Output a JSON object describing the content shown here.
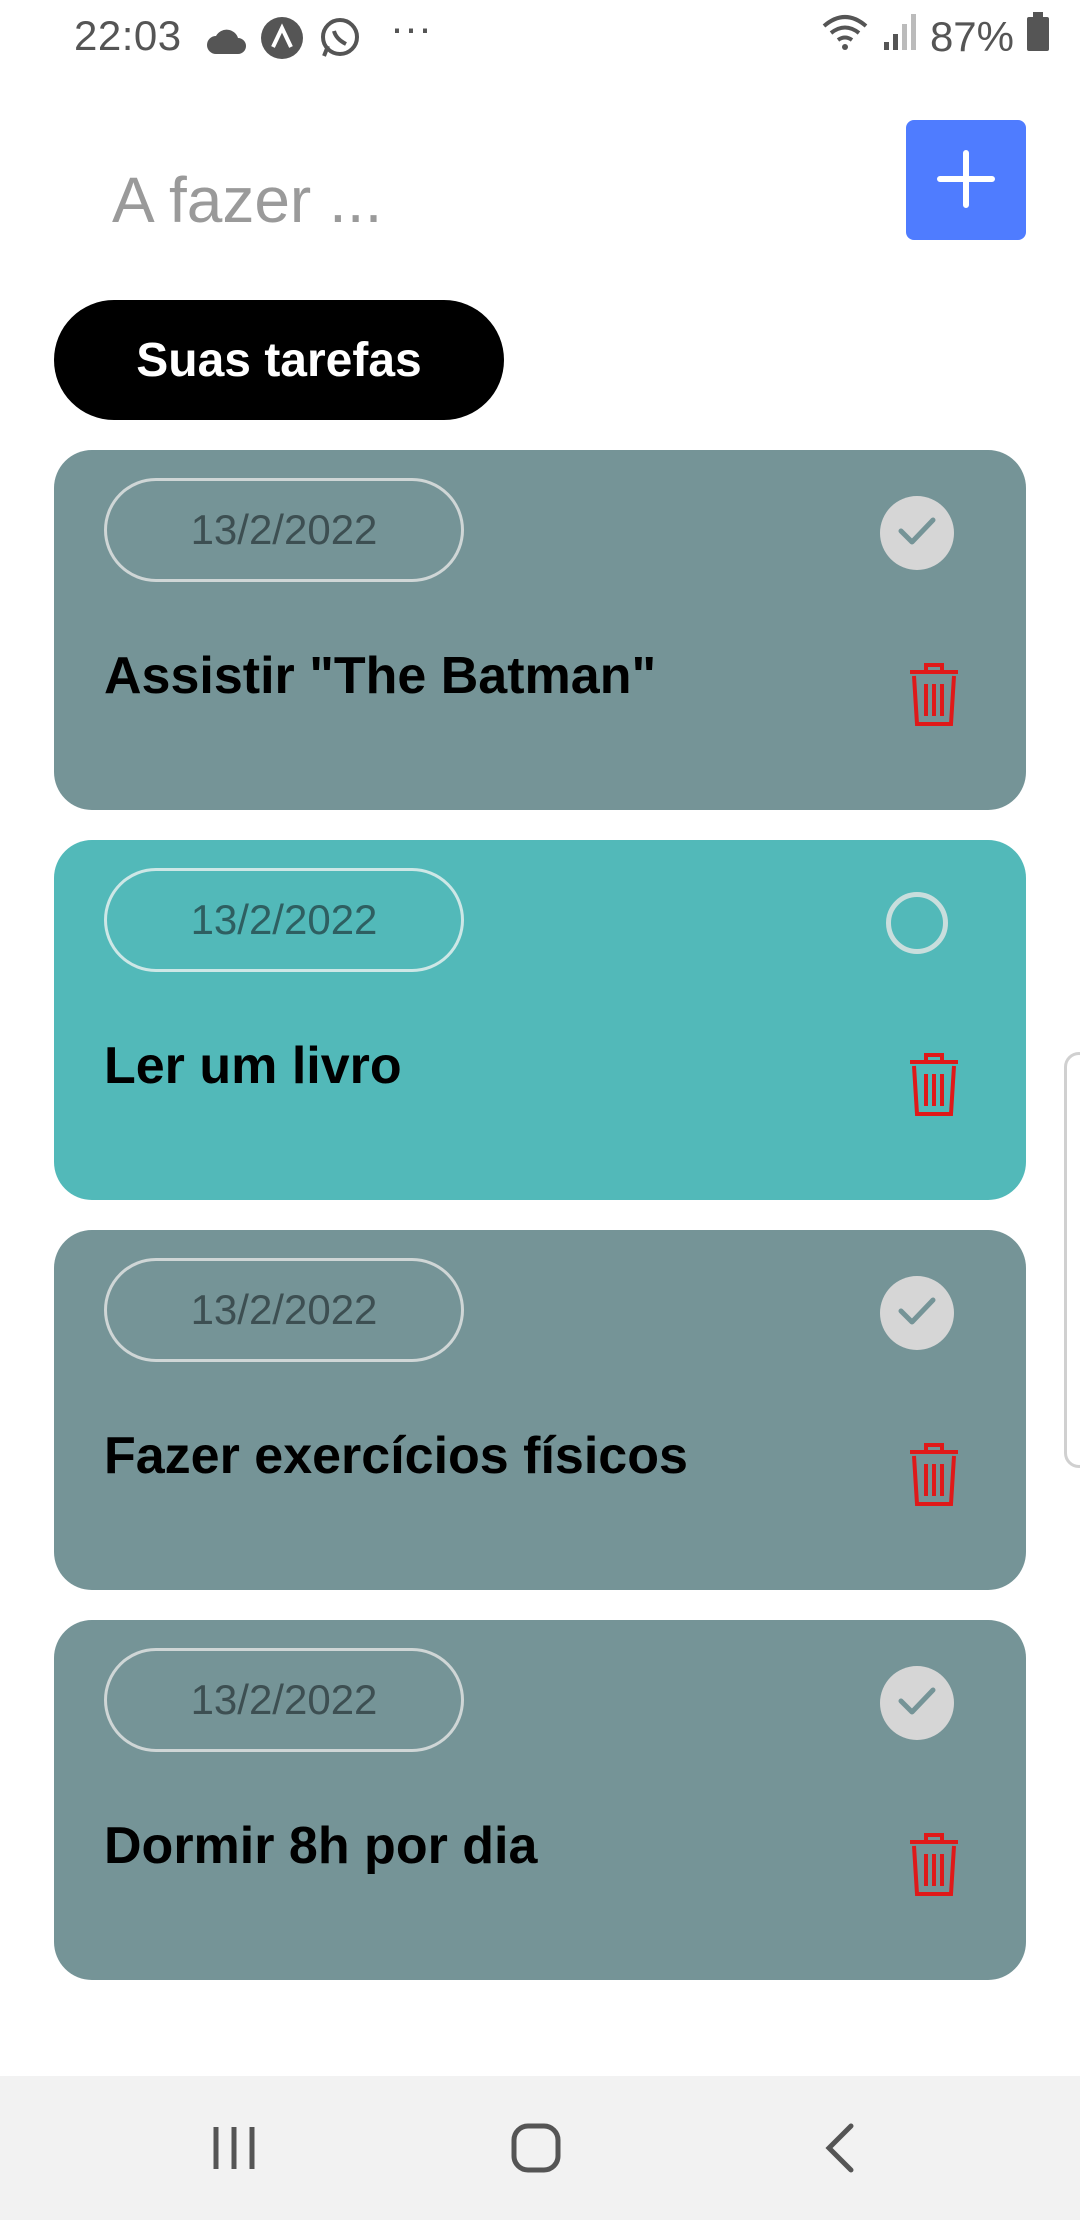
{
  "status_bar": {
    "time": "22:03",
    "battery": "87%",
    "icons": [
      "cloud-icon",
      "app-a-icon",
      "whatsapp-icon",
      "more-icon",
      "wifi-icon",
      "signal-icon",
      "battery-icon"
    ]
  },
  "add_form": {
    "placeholder": "A fazer ...",
    "value": "",
    "add_icon": "plus-icon",
    "accent_color": "#4f7cff"
  },
  "section": {
    "label": "Suas tarefas"
  },
  "tasks": [
    {
      "date": "13/2/2022",
      "title": "Assistir \"The Batman\"",
      "done": true
    },
    {
      "date": "13/2/2022",
      "title": "Ler um livro",
      "done": false
    },
    {
      "date": "13/2/2022",
      "title": "Fazer exercícios físicos",
      "done": true
    },
    {
      "date": "13/2/2022",
      "title": "Dormir 8h por dia",
      "done": true
    }
  ],
  "colors": {
    "done_card": "#759497",
    "open_card": "#52b9b9",
    "delete": "#e01919"
  },
  "nav": [
    "recents-icon",
    "home-icon",
    "back-icon"
  ]
}
